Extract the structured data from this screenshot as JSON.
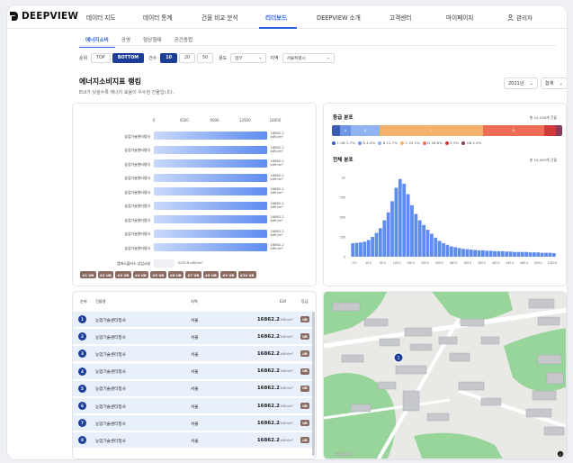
{
  "header": {
    "brand": "DEEPVIEW",
    "nav": [
      "데이터 지도",
      "데이터 통계",
      "건물 비교 분석",
      "리더보드",
      "DEEPVIEW 소개",
      "고객센터",
      "마이페이지"
    ],
    "active_nav": "리더보드",
    "user": "관리자"
  },
  "subtabs": {
    "items": [
      "에너지소비",
      "공영",
      "형상형태",
      "공간종합"
    ],
    "active": "에너지소비"
  },
  "filters": {
    "order_label": "순위",
    "order_options": [
      "TOP",
      "BOTTOM"
    ],
    "order_selected": "BOTTOM",
    "count_label": "건수",
    "count_options": [
      "10",
      "20",
      "50"
    ],
    "count_selected": "10",
    "use_label": "용도",
    "use_value": "업무",
    "region_label": "지역",
    "region_value": "서울특별시"
  },
  "main": {
    "title": "에너지소비지표 랭킹",
    "subtitle": "EUI가 낮을수록 에너지 효율이 우수한 건물입니다.",
    "year": "2021년",
    "sum": "합계"
  },
  "ranking_chart": {
    "axis_ticks": [
      "0",
      "4500",
      "9000",
      "13500",
      "18000"
    ],
    "bars": [
      {
        "label": "농업기술센터청사",
        "value": "16862.2",
        "unit": "kWh/m²"
      },
      {
        "label": "농업기술센터청사",
        "value": "16862.2",
        "unit": "kWh/m²"
      },
      {
        "label": "농업기술센터청사",
        "value": "16862.2",
        "unit": "kWh/m²"
      },
      {
        "label": "농업기술센터청사",
        "value": "16862.2",
        "unit": "kWh/m²"
      },
      {
        "label": "농업기술센터청사",
        "value": "16862.2",
        "unit": "kWh/m²"
      },
      {
        "label": "농업기술센터청사",
        "value": "16862.2",
        "unit": "kWh/m²"
      },
      {
        "label": "농업기술센터청사",
        "value": "16862.2",
        "unit": "kWh/m²"
      },
      {
        "label": "농업기술센터청사",
        "value": "16862.2",
        "unit": "kWh/m²"
      },
      {
        "label": "농업기술센터청사",
        "value": "16862.2",
        "unit": "kWh/m²"
      }
    ],
    "avg": {
      "label": "캠퍼스플러스 상업시설",
      "value": "3130.8",
      "unit": "kWh/m²"
    },
    "badges": [
      "#1 UB",
      "#2 UB",
      "#3 UB",
      "#4 UB",
      "#5 UB",
      "#6 UB",
      "#7 UB",
      "#8 UB",
      "#9 UB",
      "#10 UB"
    ]
  },
  "grade_dist": {
    "title": "등급 분포",
    "total": "총 10,258개 건물",
    "segments": [
      {
        "grade": "",
        "pct": 3.7,
        "color": "#3b5bb5"
      },
      {
        "grade": "A",
        "pct": 4.4,
        "color": "#6f95e6"
      },
      {
        "grade": "B",
        "pct": 12.7,
        "color": "#8fb4f1"
      },
      {
        "grade": "C",
        "pct": 45.1,
        "color": "#f3b16c"
      },
      {
        "grade": "D",
        "pct": 26.6,
        "color": "#ee6e55"
      },
      {
        "grade": "",
        "pct": 5,
        "color": "#cf3b3b"
      },
      {
        "grade": "",
        "pct": 2.9,
        "color": "#8d3a5a"
      }
    ],
    "legend": [
      {
        "label": "1 UB",
        "pct": "3.7%",
        "color": "#3b5bb5"
      },
      {
        "label": "A",
        "pct": "4.4%",
        "color": "#6f95e6"
      },
      {
        "label": "B",
        "pct": "12.7%",
        "color": "#8fb4f1"
      },
      {
        "label": "C",
        "pct": "45.1%",
        "color": "#f3b16c"
      },
      {
        "label": "D",
        "pct": "26.6%",
        "color": "#ee6e55"
      },
      {
        "label": "E",
        "pct": "5%",
        "color": "#cf3b3b"
      },
      {
        "label": "UB",
        "pct": "2.9%",
        "color": "#8d3a5a"
      }
    ]
  },
  "overall_dist": {
    "title": "전체 분포",
    "total": "총 10,093개 건물"
  },
  "chart_data": {
    "type": "bar",
    "x_ticks": [
      "0.0",
      "40.0",
      "80.0",
      "120.0",
      "160.0",
      "200.0",
      "240.0",
      "280.0",
      "320.0",
      "360.0",
      "400.0",
      "440.0",
      "480.0",
      "520.0",
      "1010.0"
    ],
    "y_ticks": [
      "0",
      "250",
      "500",
      "750",
      "1K"
    ],
    "ylim": [
      0,
      1000
    ],
    "values": [
      170,
      175,
      180,
      190,
      210,
      250,
      300,
      360,
      460,
      560,
      700,
      870,
      980,
      920,
      790,
      650,
      540,
      460,
      400,
      340,
      290,
      240,
      200,
      170,
      150,
      130,
      120,
      110,
      100,
      95,
      90,
      85,
      80,
      80,
      75,
      75,
      70,
      70,
      70,
      65,
      65,
      60,
      60,
      60,
      60,
      55,
      55,
      55,
      50,
      50,
      50,
      45
    ]
  },
  "table": {
    "headers": [
      "순위",
      "건물명",
      "지역",
      "EUI",
      "등급"
    ],
    "rows": [
      {
        "rank": "1",
        "name": "농업기술센터청사",
        "region": "서울",
        "eui": "16862.2",
        "unit": "kWh/m²",
        "grade": "UB"
      },
      {
        "rank": "2",
        "name": "농업기술센터청사",
        "region": "서울",
        "eui": "16862.2",
        "unit": "kWh/m²",
        "grade": "UB"
      },
      {
        "rank": "3",
        "name": "농업기술센터청사",
        "region": "서울",
        "eui": "16862.2",
        "unit": "kWh/m²",
        "grade": "UB"
      },
      {
        "rank": "4",
        "name": "농업기술센터청사",
        "region": "서울",
        "eui": "16862.2",
        "unit": "kWh/m²",
        "grade": "UB"
      },
      {
        "rank": "5",
        "name": "농업기술센터청사",
        "region": "서울",
        "eui": "16862.2",
        "unit": "kWh/m²",
        "grade": "UB"
      },
      {
        "rank": "6",
        "name": "농업기술센터청사",
        "region": "서울",
        "eui": "16862.2",
        "unit": "kWh/m²",
        "grade": "UB"
      },
      {
        "rank": "7",
        "name": "농업기술센터청사",
        "region": "서울",
        "eui": "16862.2",
        "unit": "kWh/m²",
        "grade": "UB"
      },
      {
        "rank": "8",
        "name": "농업기술센터청사",
        "region": "서울",
        "eui": "16862.2",
        "unit": "kWh/m²",
        "grade": "UB"
      }
    ]
  },
  "map": {
    "attribution": "mapbox",
    "marker": "1",
    "info_icon": "info-icon"
  }
}
